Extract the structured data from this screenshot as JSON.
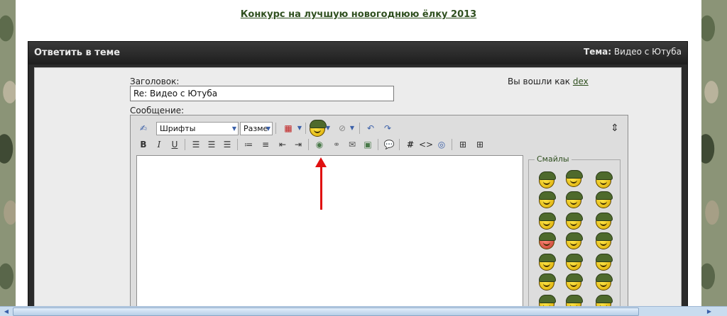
{
  "header": {
    "contest_link": "Конкурс на лучшую новогоднюю ёлку 2013",
    "frame_title": "Ответить в теме",
    "topic_label": "Тема:",
    "topic_value": "Видео с Ютуба"
  },
  "form": {
    "subject_label": "Заголовок:",
    "subject_value": "Re: Видео с Ютуба",
    "message_label": "Сообщение:",
    "logged_in_text": "Вы вошли как",
    "username": "dex"
  },
  "toolbar": {
    "font_select": "Шрифты",
    "size_select": "Разме",
    "bold": "B",
    "italic": "I",
    "underline": "U",
    "code": "#",
    "html": "<>",
    "expand": "⇕"
  },
  "smileys": {
    "legend": "Смайлы"
  }
}
